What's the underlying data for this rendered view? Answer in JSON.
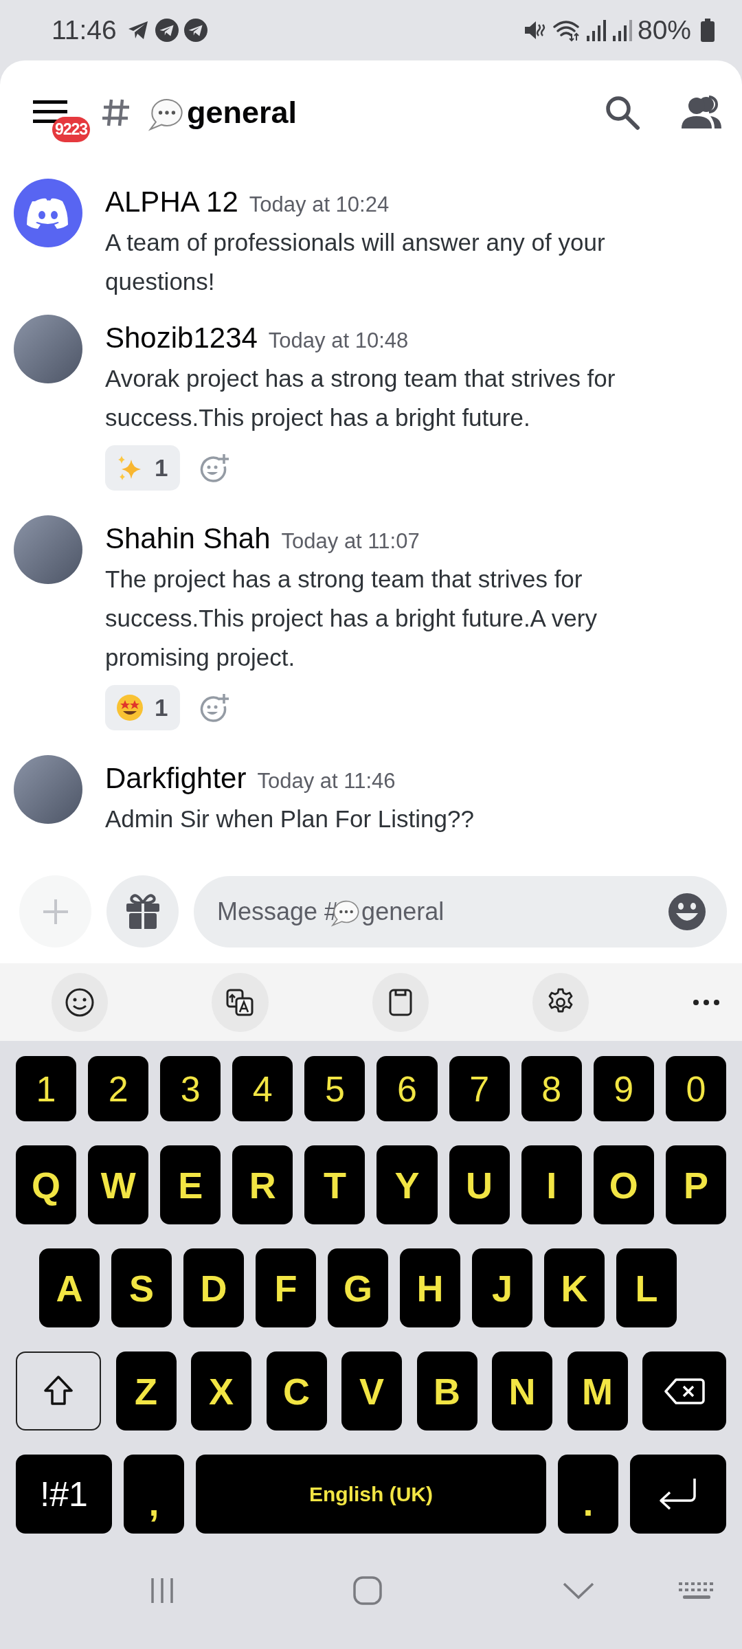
{
  "status_bar": {
    "time": "11:46",
    "battery": "80%"
  },
  "header": {
    "badge": "9223",
    "channel": "general"
  },
  "messages": [
    {
      "author": "ALPHA 12",
      "kind": "logo",
      "time": "Today at 10:24",
      "text": "A team of professionals will answer any of your questions!"
    },
    {
      "author": "Shozib1234",
      "kind": "photo",
      "time": "Today at 10:48",
      "text": "Avorak project has a strong team that strives for success.This project has a bright future.",
      "reactions": [
        {
          "kind": "sparkles",
          "count": "1"
        }
      ]
    },
    {
      "author": "Shahin Shah",
      "kind": "photo",
      "time": "Today at 11:07",
      "text": "The project has a strong team that strives for success.This project has a bright future.A very promising project.",
      "reactions": [
        {
          "kind": "star-struck",
          "count": "1"
        }
      ]
    },
    {
      "author": "Darkfighter",
      "kind": "photo",
      "time": "Today at 11:46",
      "text": "Admin Sir when Plan For Listing??"
    }
  ],
  "composer": {
    "placeholder_prefix": "Message #",
    "placeholder_channel": "general"
  },
  "keyboard": {
    "rows": [
      {
        "keys": [
          {
            "kind": "char",
            "label": "1"
          },
          {
            "kind": "char",
            "label": "2"
          },
          {
            "kind": "char",
            "label": "3"
          },
          {
            "kind": "char",
            "label": "4"
          },
          {
            "kind": "char",
            "label": "5"
          },
          {
            "kind": "char",
            "label": "6"
          },
          {
            "kind": "char",
            "label": "7"
          },
          {
            "kind": "char",
            "label": "8"
          },
          {
            "kind": "char",
            "label": "9"
          },
          {
            "kind": "char",
            "label": "0"
          }
        ]
      },
      {
        "keys": [
          {
            "kind": "char",
            "label": "Q"
          },
          {
            "kind": "char",
            "label": "W"
          },
          {
            "kind": "char",
            "label": "E"
          },
          {
            "kind": "char",
            "label": "R"
          },
          {
            "kind": "char",
            "label": "T"
          },
          {
            "kind": "char",
            "label": "Y"
          },
          {
            "kind": "char",
            "label": "U"
          },
          {
            "kind": "char",
            "label": "I"
          },
          {
            "kind": "char",
            "label": "O"
          },
          {
            "kind": "char",
            "label": "P"
          }
        ]
      },
      {
        "keys": [
          {
            "kind": "char",
            "label": "A"
          },
          {
            "kind": "char",
            "label": "S"
          },
          {
            "kind": "char",
            "label": "D"
          },
          {
            "kind": "char",
            "label": "F"
          },
          {
            "kind": "char",
            "label": "G"
          },
          {
            "kind": "char",
            "label": "H"
          },
          {
            "kind": "char",
            "label": "J"
          },
          {
            "kind": "char",
            "label": "K"
          },
          {
            "kind": "char",
            "label": "L"
          }
        ]
      },
      {
        "keys": [
          {
            "kind": "shift"
          },
          {
            "kind": "char",
            "label": "Z"
          },
          {
            "kind": "char",
            "label": "X"
          },
          {
            "kind": "char",
            "label": "C"
          },
          {
            "kind": "char",
            "label": "V"
          },
          {
            "kind": "char",
            "label": "B"
          },
          {
            "kind": "char",
            "label": "N"
          },
          {
            "kind": "char",
            "label": "M"
          },
          {
            "kind": "backspace"
          }
        ]
      },
      {
        "keys": [
          {
            "kind": "symbols",
            "label": "!#1"
          },
          {
            "kind": "punct",
            "label": ","
          },
          {
            "kind": "space",
            "label": "English (UK)"
          },
          {
            "kind": "punct",
            "label": "."
          },
          {
            "kind": "enter"
          }
        ]
      }
    ]
  }
}
